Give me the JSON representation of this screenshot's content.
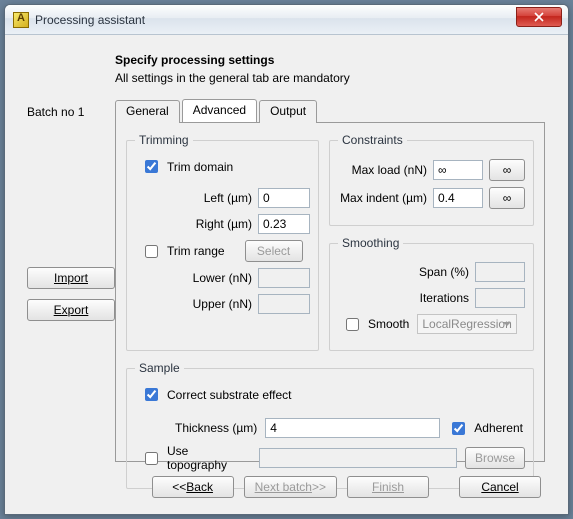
{
  "window": {
    "title": "Processing assistant"
  },
  "header": {
    "title": "Specify processing settings",
    "subtitle": "All settings in the general tab are mandatory"
  },
  "batch_label": "Batch no 1",
  "side": {
    "import": "Import",
    "export": "Export"
  },
  "tabs": {
    "general": "General",
    "advanced": "Advanced",
    "output": "Output"
  },
  "trimming": {
    "legend": "Trimming",
    "trim_domain_label": "Trim domain",
    "trim_domain_checked": true,
    "left_label": "Left (µm)",
    "left_value": "0",
    "right_label": "Right (µm)",
    "right_value": "0.23",
    "trim_range_label": "Trim range",
    "trim_range_checked": false,
    "select_btn": "Select",
    "lower_label": "Lower (nN)",
    "lower_value": "",
    "upper_label": "Upper (nN)",
    "upper_value": ""
  },
  "constraints": {
    "legend": "Constraints",
    "max_load_label": "Max load (nN)",
    "max_load_value": "∞",
    "max_indent_label": "Max indent (µm)",
    "max_indent_value": "0.4",
    "inf_symbol": "∞"
  },
  "smoothing": {
    "legend": "Smoothing",
    "span_label": "Span (%)",
    "span_value": "",
    "iter_label": "Iterations",
    "iter_value": "",
    "smooth_label": "Smooth",
    "smooth_checked": false,
    "method": "LocalRegression"
  },
  "sample": {
    "legend": "Sample",
    "correct_label": "Correct substrate effect",
    "correct_checked": true,
    "thickness_label": "Thickness (µm)",
    "thickness_value": "4",
    "adherent_label": "Adherent",
    "adherent_checked": true,
    "use_topo_label": "Use topography",
    "use_topo_checked": false,
    "topo_path": "",
    "browse_btn": "Browse"
  },
  "footer": {
    "back_prefix": "<<  ",
    "back": "Back",
    "next": "Next batch",
    "next_suffix": "  >>",
    "finish": "Finish",
    "cancel": "Cancel"
  }
}
